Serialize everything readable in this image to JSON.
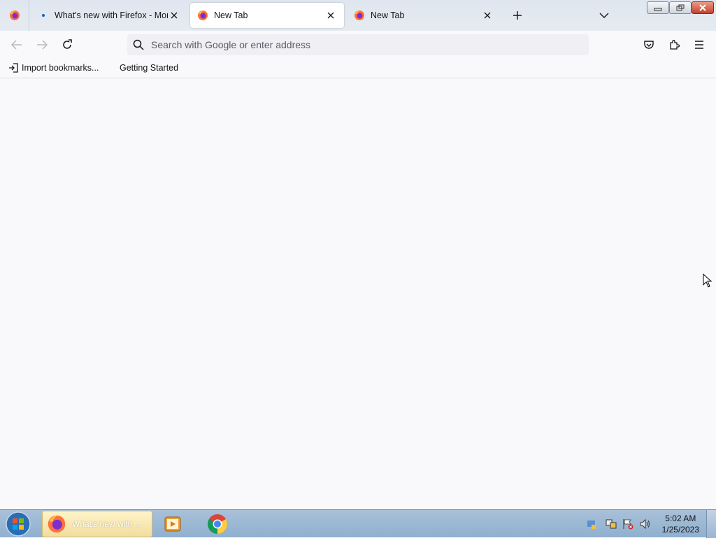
{
  "tabs": [
    {
      "title": "What's new with Firefox - More",
      "selected": false,
      "has_indicator": true
    },
    {
      "title": "New Tab",
      "selected": true
    },
    {
      "title": "New Tab",
      "selected": false
    }
  ],
  "icons": {
    "firefox_menu": "firefox-icon",
    "new_tab": "plus-icon",
    "list_all_tabs": "chevron-down-icon",
    "back": "arrow-left-icon",
    "forward": "arrow-right-icon",
    "reload": "reload-icon",
    "search": "search-icon",
    "pocket": "pocket-icon",
    "extensions": "puzzle-icon",
    "menu": "hamburger-icon"
  },
  "urlbar": {
    "placeholder": "Search with Google or enter address",
    "value": ""
  },
  "bookmarks": [
    {
      "label": "Import bookmarks..."
    },
    {
      "label": "Getting Started"
    }
  ],
  "taskbar": {
    "active_window_label": "What's new with ...",
    "clock_time": "5:02 AM",
    "clock_date": "1/25/2023"
  },
  "colors": {
    "accent": "#0060df",
    "content_bg": "#f9f9fb",
    "taskbar": "#9ab6d3"
  }
}
